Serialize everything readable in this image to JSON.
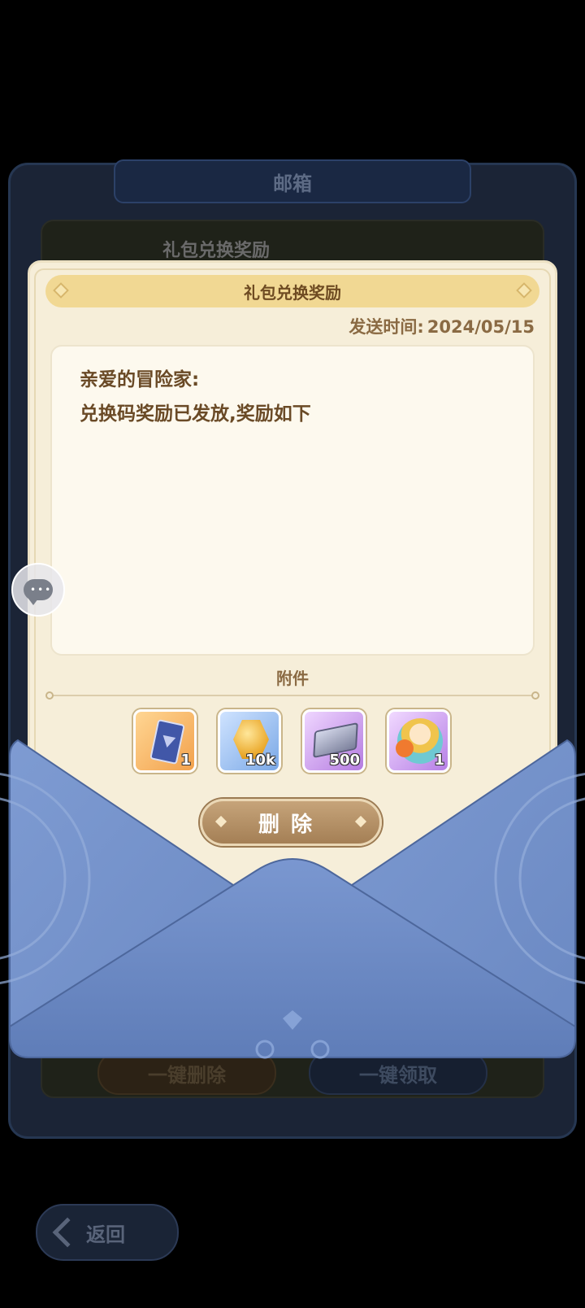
{
  "mailbox": {
    "title": "邮箱",
    "list_item_title": "礼包兑换奖励",
    "delete_all_label": "一键删除",
    "claim_all_label": "一键领取"
  },
  "back": {
    "label": "返回"
  },
  "letter": {
    "title": "礼包兑换奖励",
    "send_time_label": "发送时间:",
    "send_time_value": "2024/05/15",
    "greeting": "亲爱的冒险家:",
    "body": "兑换码奖励已发放,奖励如下",
    "attachments_label": "附件",
    "attachments": [
      {
        "icon": "card-icon",
        "count": "1"
      },
      {
        "icon": "coin-icon",
        "count": "10k"
      },
      {
        "icon": "ingot-icon",
        "count": "500"
      },
      {
        "icon": "avatar-frame-icon",
        "count": "1"
      }
    ],
    "delete_label": "删除"
  },
  "colors": {
    "envelope": "#7090c8",
    "letter_bg": "#f6eed9",
    "header_bg": "#f1d893",
    "text_brown": "#6a4a26",
    "button_tan": "#b08b60"
  }
}
